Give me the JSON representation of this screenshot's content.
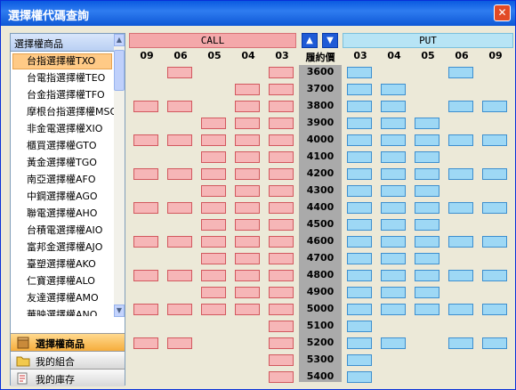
{
  "window": {
    "title": "選擇權代碼查詢"
  },
  "sidebar": {
    "header": "選擇權商品",
    "items": [
      "台指選擇權TXO",
      "台電指選擇權TEO",
      "台金指選擇權TFO",
      "摩根台指選擇權MSO",
      "非金電選擇權XIO",
      "櫃買選擇權GTO",
      "黃金選擇權TGO",
      "南亞選擇權AFO",
      "中鋼選擇權AGO",
      "聯電選擇權AHO",
      "台積電選擇權AIO",
      "富邦金選擇權AJO",
      "臺塑選擇權AKO",
      "仁寶選擇權ALO",
      "友達選擇權AMO",
      "華映選擇權ANO"
    ],
    "selected_index": 0,
    "nav": [
      {
        "label": "選擇權商品",
        "icon": "box-icon",
        "active": true
      },
      {
        "label": "我的組合",
        "icon": "folder-icon",
        "active": false
      },
      {
        "label": "我的庫存",
        "icon": "inventory-icon",
        "active": false
      }
    ]
  },
  "grid": {
    "call_label": "CALL",
    "put_label": "PUT",
    "strike_label": "履約價",
    "call_months": [
      "09",
      "06",
      "05",
      "04",
      "03"
    ],
    "put_months": [
      "03",
      "04",
      "05",
      "06",
      "09"
    ],
    "strikes": [
      "3600",
      "3700",
      "3800",
      "3900",
      "4000",
      "4100",
      "4200",
      "4300",
      "4400",
      "4500",
      "4600",
      "4700",
      "4800",
      "4900",
      "5000",
      "5100",
      "5200",
      "5300",
      "5400"
    ],
    "call_cells": [
      [
        0,
        1,
        0,
        0,
        1
      ],
      [
        0,
        0,
        0,
        1,
        1
      ],
      [
        1,
        1,
        0,
        1,
        1
      ],
      [
        0,
        0,
        1,
        1,
        1
      ],
      [
        1,
        1,
        1,
        1,
        1
      ],
      [
        0,
        0,
        1,
        1,
        1
      ],
      [
        1,
        1,
        1,
        1,
        1
      ],
      [
        0,
        0,
        1,
        1,
        1
      ],
      [
        1,
        1,
        1,
        1,
        1
      ],
      [
        0,
        0,
        1,
        1,
        1
      ],
      [
        1,
        1,
        1,
        1,
        1
      ],
      [
        0,
        0,
        1,
        1,
        1
      ],
      [
        1,
        1,
        1,
        1,
        1
      ],
      [
        0,
        0,
        1,
        1,
        1
      ],
      [
        1,
        1,
        1,
        1,
        1
      ],
      [
        0,
        0,
        0,
        0,
        1
      ],
      [
        1,
        1,
        0,
        0,
        1
      ],
      [
        0,
        0,
        0,
        0,
        1
      ],
      [
        0,
        0,
        0,
        0,
        1
      ]
    ],
    "put_cells": [
      [
        1,
        0,
        0,
        1,
        0
      ],
      [
        1,
        1,
        0,
        0,
        0
      ],
      [
        1,
        1,
        0,
        1,
        1
      ],
      [
        1,
        1,
        1,
        0,
        0
      ],
      [
        1,
        1,
        1,
        1,
        1
      ],
      [
        1,
        1,
        1,
        0,
        0
      ],
      [
        1,
        1,
        1,
        1,
        1
      ],
      [
        1,
        1,
        1,
        0,
        0
      ],
      [
        1,
        1,
        1,
        1,
        1
      ],
      [
        1,
        1,
        1,
        0,
        0
      ],
      [
        1,
        1,
        1,
        1,
        1
      ],
      [
        1,
        1,
        1,
        0,
        0
      ],
      [
        1,
        1,
        1,
        1,
        1
      ],
      [
        1,
        1,
        1,
        0,
        0
      ],
      [
        1,
        1,
        1,
        1,
        1
      ],
      [
        1,
        0,
        0,
        0,
        0
      ],
      [
        1,
        1,
        0,
        1,
        1
      ],
      [
        1,
        0,
        0,
        0,
        0
      ],
      [
        1,
        0,
        0,
        0,
        0
      ]
    ],
    "colors": {
      "call_fill": "#f6b6b7",
      "put_fill": "#9ed8f5",
      "strike_bg": "#aaaaaa"
    }
  }
}
